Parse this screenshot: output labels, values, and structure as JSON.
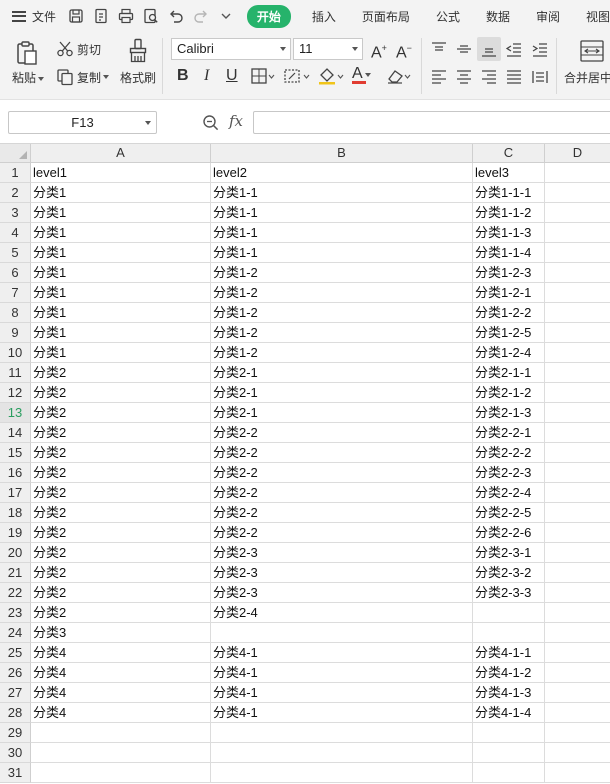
{
  "menubar": {
    "file_label": "文件",
    "tabs": [
      "开始",
      "插入",
      "页面布局",
      "公式",
      "数据",
      "审阅",
      "视图"
    ],
    "active_tab": "开始"
  },
  "ribbon": {
    "paste_label": "粘贴",
    "cut_label": "剪切",
    "copy_label": "复制",
    "format_painter_label": "格式刷",
    "font_name": "Calibri",
    "font_size": "11",
    "merge_label": "合并居中"
  },
  "formula_bar": {
    "name_box": "F13",
    "fx_label": "fx",
    "formula_value": ""
  },
  "sheet": {
    "columns": [
      "A",
      "B",
      "C",
      "D"
    ],
    "selected_row": 13,
    "row_numbers": [
      "1",
      "2",
      "3",
      "4",
      "5",
      "6",
      "7",
      "8",
      "9",
      "10",
      "11",
      "12",
      "13",
      "14",
      "15",
      "16",
      "17",
      "18",
      "19",
      "20",
      "21",
      "22",
      "23",
      "24",
      "25",
      "26",
      "27",
      "28",
      "29",
      "30",
      "31"
    ],
    "rows": [
      [
        "level1",
        "level2",
        "level3",
        ""
      ],
      [
        "分类1",
        "分类1-1",
        "分类1-1-1",
        ""
      ],
      [
        "分类1",
        "分类1-1",
        "分类1-1-2",
        ""
      ],
      [
        "分类1",
        "分类1-1",
        "分类1-1-3",
        ""
      ],
      [
        "分类1",
        "分类1-1",
        "分类1-1-4",
        ""
      ],
      [
        "分类1",
        "分类1-2",
        "分类1-2-3",
        ""
      ],
      [
        "分类1",
        "分类1-2",
        "分类1-2-1",
        ""
      ],
      [
        "分类1",
        "分类1-2",
        "分类1-2-2",
        ""
      ],
      [
        "分类1",
        "分类1-2",
        "分类1-2-5",
        ""
      ],
      [
        "分类1",
        "分类1-2",
        "分类1-2-4",
        ""
      ],
      [
        "分类2",
        "分类2-1",
        "分类2-1-1",
        ""
      ],
      [
        "分类2",
        "分类2-1",
        "分类2-1-2",
        ""
      ],
      [
        "分类2",
        "分类2-1",
        "分类2-1-3",
        ""
      ],
      [
        "分类2",
        "分类2-2",
        "分类2-2-1",
        ""
      ],
      [
        "分类2",
        "分类2-2",
        "分类2-2-2",
        ""
      ],
      [
        "分类2",
        "分类2-2",
        "分类2-2-3",
        ""
      ],
      [
        "分类2",
        "分类2-2",
        "分类2-2-4",
        ""
      ],
      [
        "分类2",
        "分类2-2",
        "分类2-2-5",
        ""
      ],
      [
        "分类2",
        "分类2-2",
        "分类2-2-6",
        ""
      ],
      [
        "分类2",
        "分类2-3",
        "分类2-3-1",
        ""
      ],
      [
        "分类2",
        "分类2-3",
        "分类2-3-2",
        ""
      ],
      [
        "分类2",
        "分类2-3",
        "分类2-3-3",
        ""
      ],
      [
        "分类2",
        "分类2-4",
        "",
        ""
      ],
      [
        "分类3",
        "",
        "",
        ""
      ],
      [
        "分类4",
        "分类4-1",
        "分类4-1-1",
        ""
      ],
      [
        "分类4",
        "分类4-1",
        "分类4-1-2",
        ""
      ],
      [
        "分类4",
        "分类4-1",
        "分类4-1-3",
        ""
      ],
      [
        "分类4",
        "分类4-1",
        "分类4-1-4",
        ""
      ],
      [
        "",
        "",
        "",
        ""
      ],
      [
        "",
        "",
        "",
        ""
      ],
      [
        "",
        "",
        "",
        ""
      ]
    ]
  },
  "colors": {
    "accent": "#26b36b",
    "selected_row_text": "#2a9d5f"
  }
}
